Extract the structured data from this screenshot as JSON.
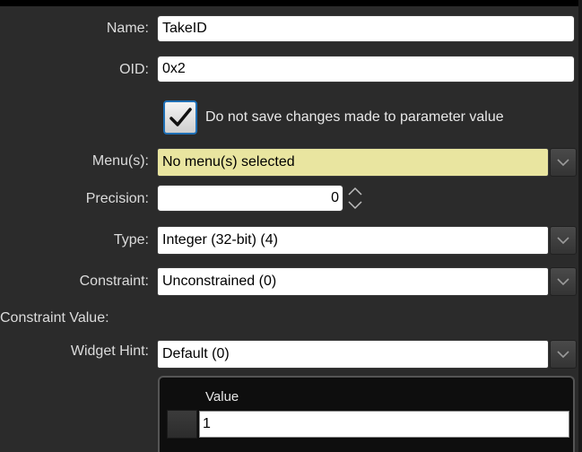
{
  "form": {
    "name_label": "Name:",
    "name_value": "TakeID",
    "oid_label": "OID:",
    "oid_value": "0x2",
    "no_save_checked": true,
    "no_save_label": "Do not save changes made to parameter value",
    "menus_label": "Menu(s):",
    "menus_value": "No menu(s) selected",
    "precision_label": "Precision:",
    "precision_value": "0",
    "type_label": "Type:",
    "type_value": "Integer (32-bit) (4)",
    "constraint_label": "Constraint:",
    "constraint_value": "Unconstrained (0)",
    "constraint_value_label": "Constraint Value:",
    "widget_hint_label": "Widget Hint:",
    "widget_hint_value": "Default (0)"
  },
  "value_table": {
    "column_header": "Value",
    "rows": [
      "1"
    ]
  },
  "colors": {
    "background": "#2b2b2b",
    "menus_field": "#e9e5a0",
    "checkbox_border": "#1f6fb5"
  },
  "icons": {
    "dropdown": "chevron-down-icon",
    "check": "checkmark-icon",
    "spin": "spin-up-down-icon"
  }
}
